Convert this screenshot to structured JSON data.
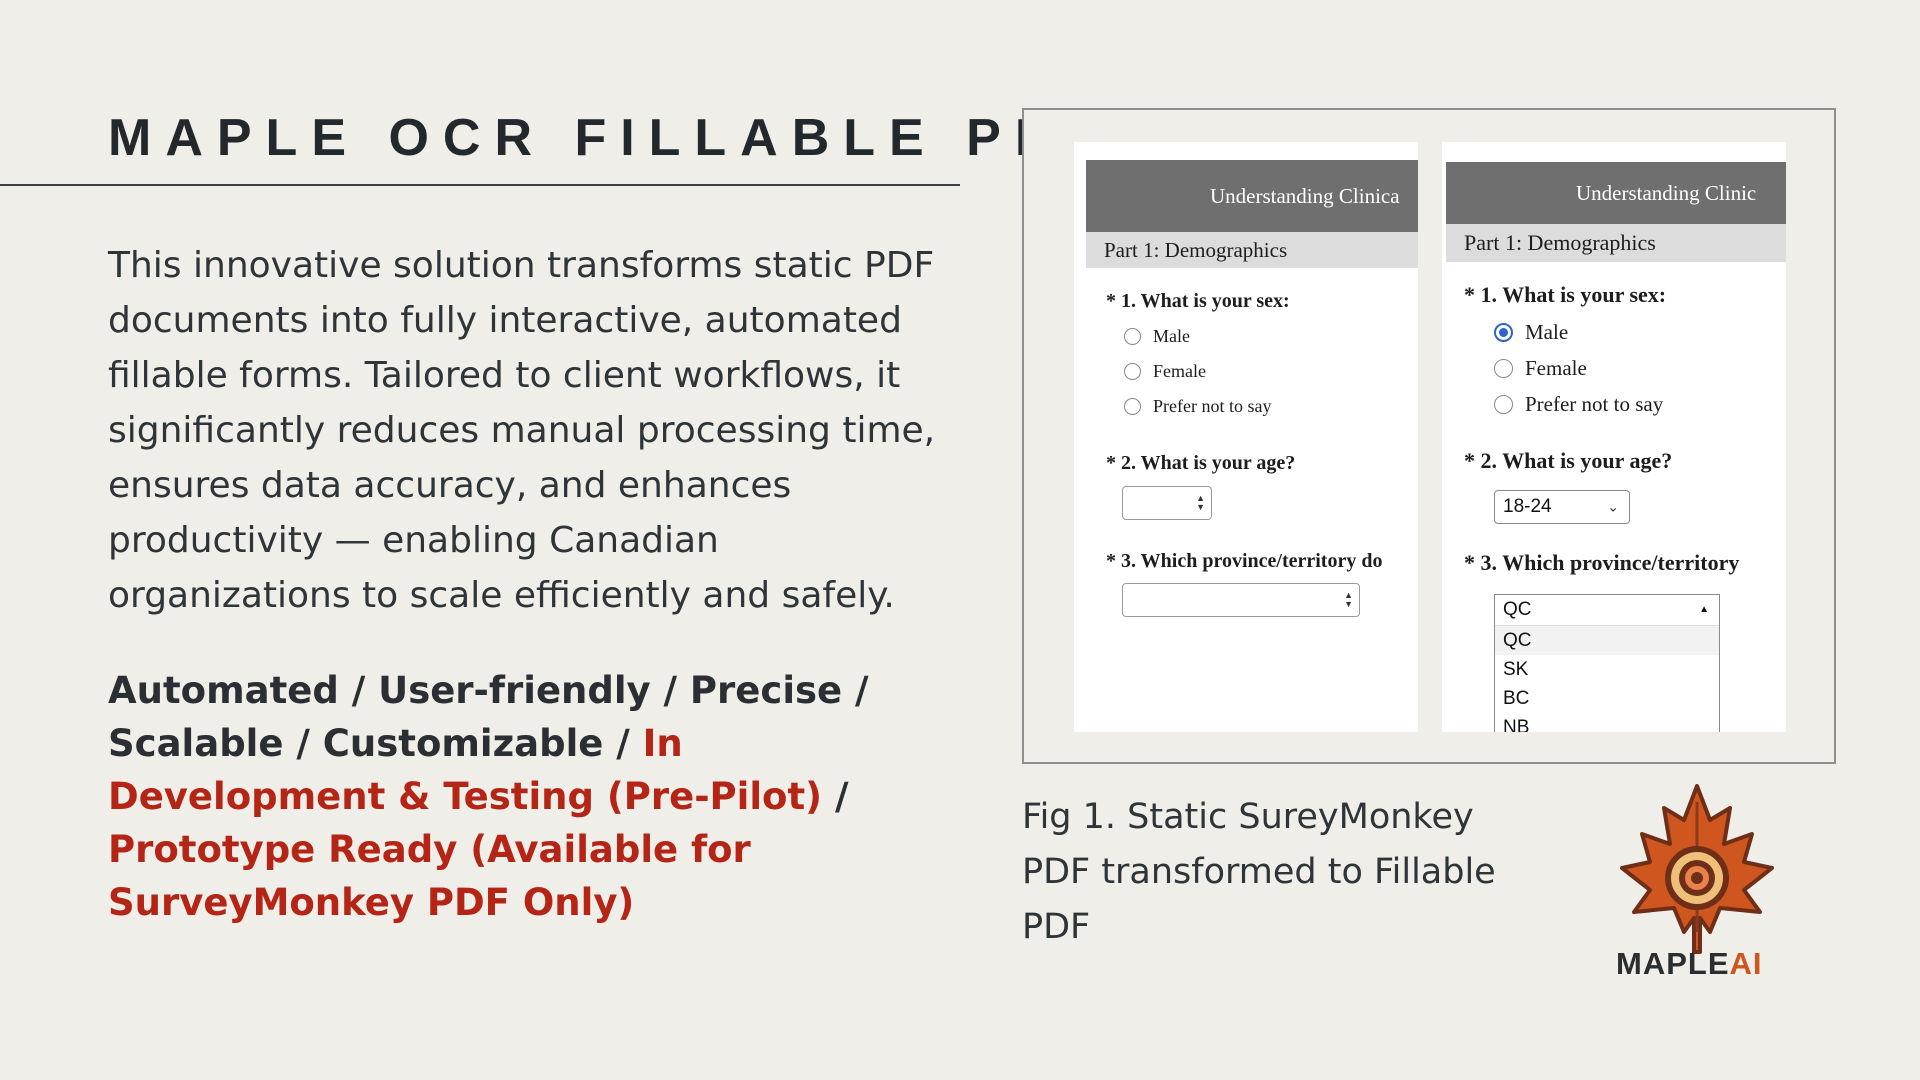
{
  "title": "MAPLE OCR FILLABLE PDF",
  "description": "This innovative solution transforms static PDF documents into fully interactive, automated fillable forms. Tailored to client workflows, it significantly reduces manual processing time, ensures data accuracy, and enhances productivity — enabling Canadian organizations to scale efficiently and safely.",
  "features": {
    "normal": "Automated / User-friendly / Precise / Scalable / Customizable /",
    "status1": "In Development & Testing (Pre-Pilot)",
    "separator": "/",
    "status2": "Prototype Ready (Available for SurveyMonkey PDF Only)"
  },
  "figure": {
    "static_form": {
      "header": "Understanding Clinica",
      "part": "Part 1: Demographics",
      "q1": "* 1. What is your sex:",
      "options": [
        "Male",
        "Female",
        "Prefer not to say"
      ],
      "q2": "* 2. What is your age?",
      "q3": "* 3. Which province/territory do"
    },
    "fillable_form": {
      "header": "Understanding Clinic",
      "part": "Part 1: Demographics",
      "q1": "* 1. What is your sex:",
      "options": [
        "Male",
        "Female",
        "Prefer not to say"
      ],
      "selected_option": "Male",
      "q2": "* 2. What is your age?",
      "age_value": "18-24",
      "q3": "* 3. Which province/territory",
      "province_value": "QC",
      "province_options": [
        "QC",
        "SK",
        "BC",
        "NB"
      ]
    }
  },
  "caption": "Fig 1. Static SureyMonkey PDF transformed to Fillable PDF",
  "logo": {
    "text_main": "MAPLE",
    "text_accent": "AI",
    "colors": {
      "leaf": "#d0561f",
      "leaf_dark": "#8a3a1e",
      "ring": "#f0c07a"
    }
  },
  "colors": {
    "background": "#efeee8",
    "accent_red": "#b42516",
    "text": "#2f3438",
    "radio_selected": "#2f63c9"
  }
}
